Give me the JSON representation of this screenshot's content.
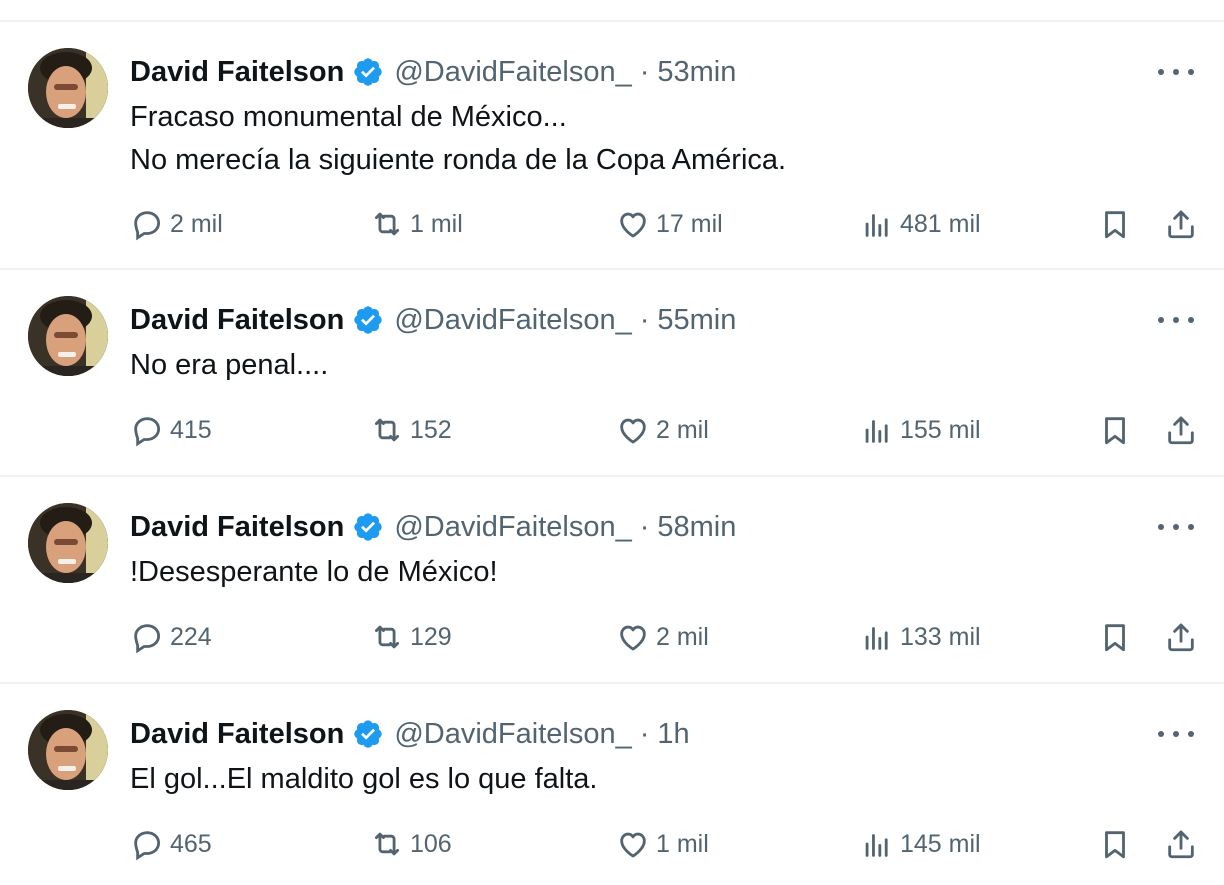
{
  "author": {
    "name": "David Faitelson",
    "handle": "@DavidFaitelson_",
    "separator": "·"
  },
  "tweets": [
    {
      "time": "53min",
      "lines": [
        "Fracaso monumental de México...",
        "No merecía la siguiente ronda de la Copa América."
      ],
      "replies": "2 mil",
      "reposts": "1 mil",
      "likes": "17 mil",
      "views": "481 mil"
    },
    {
      "time": "55min",
      "lines": [
        "No era penal...."
      ],
      "replies": "415",
      "reposts": "152",
      "likes": "2 mil",
      "views": "155 mil"
    },
    {
      "time": "58min",
      "lines": [
        "!Desesperante lo de México!"
      ],
      "replies": "224",
      "reposts": "129",
      "likes": "2 mil",
      "views": "133 mil"
    },
    {
      "time": "1h",
      "lines": [
        "El gol...El maldito gol es lo que falta."
      ],
      "replies": "465",
      "reposts": "106",
      "likes": "1 mil",
      "views": "145 mil"
    }
  ],
  "colors": {
    "verified": "#1d9bf0",
    "muted": "#536471",
    "text": "#0f1419",
    "divider": "#eff3f4"
  },
  "icons": [
    "verified-badge-icon",
    "more-icon",
    "reply-icon",
    "repost-icon",
    "like-icon",
    "views-icon",
    "bookmark-icon",
    "share-icon"
  ]
}
